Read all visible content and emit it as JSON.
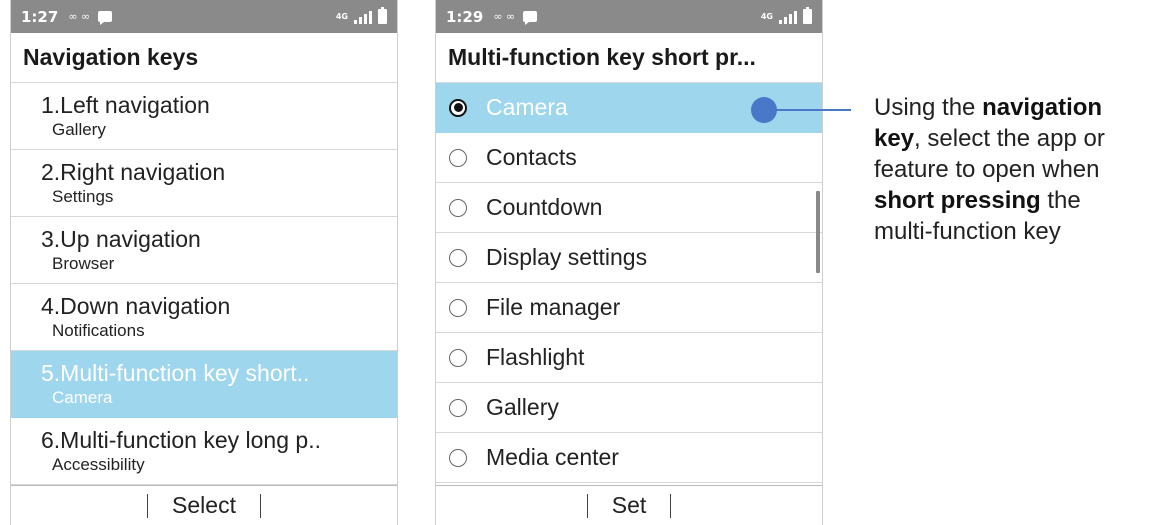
{
  "left_screen": {
    "status": {
      "time": "1:27",
      "icons": "∞ ∞",
      "network": "4G"
    },
    "title": "Navigation keys",
    "items": [
      {
        "title": "1.Left navigation",
        "sub": "Gallery",
        "selected": false
      },
      {
        "title": "2.Right navigation",
        "sub": "Settings",
        "selected": false
      },
      {
        "title": "3.Up navigation",
        "sub": "Browser",
        "selected": false
      },
      {
        "title": "4.Down navigation",
        "sub": "Notifications",
        "selected": false
      },
      {
        "title": "5.Multi-function key short..",
        "sub": "Camera",
        "selected": true
      },
      {
        "title": "6.Multi-function key long p..",
        "sub": "Accessibility",
        "selected": false
      }
    ],
    "softkey": "Select"
  },
  "right_screen": {
    "status": {
      "time": "1:29",
      "icons": "∞ ∞",
      "network": "4G"
    },
    "title": "Multi-function key short pr...",
    "items": [
      {
        "label": "Camera",
        "selected": true
      },
      {
        "label": "Contacts",
        "selected": false
      },
      {
        "label": "Countdown",
        "selected": false
      },
      {
        "label": "Display settings",
        "selected": false
      },
      {
        "label": "File manager",
        "selected": false
      },
      {
        "label": "Flashlight",
        "selected": false
      },
      {
        "label": "Gallery",
        "selected": false
      },
      {
        "label": "Media center",
        "selected": false
      }
    ],
    "softkey": "Set"
  },
  "callout": {
    "line1_pre": "Using the ",
    "line1_bold": "navigation",
    "line2_bold": "key",
    "line2_post": ", select the app or",
    "line3": "feature to open when",
    "line4_bold": "short pressing",
    "line4_post": " the",
    "line5": "multi-function key"
  },
  "colors": {
    "selection": "#9ed6ee",
    "callout": "#4a78c8",
    "statusbar": "#8a8a8a"
  }
}
